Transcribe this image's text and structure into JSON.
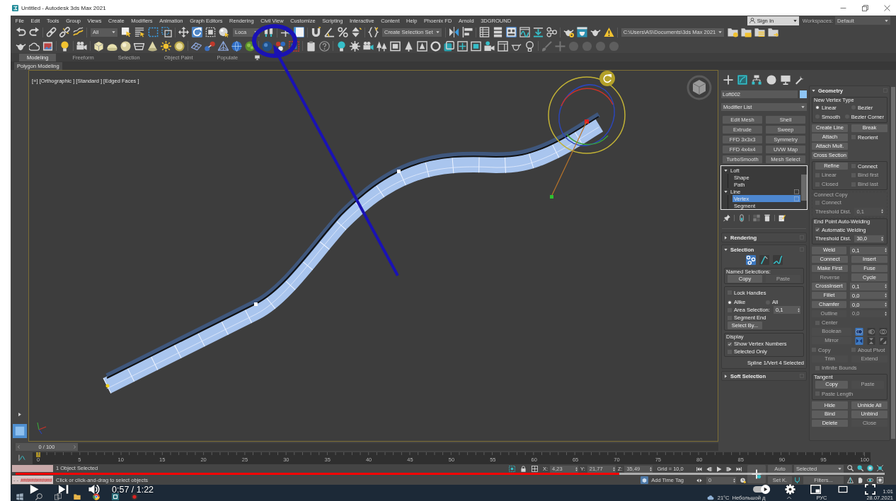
{
  "window": {
    "title": "Untitled - Autodesk 3ds Max 2021"
  },
  "menu": [
    "File",
    "Edit",
    "Tools",
    "Group",
    "Views",
    "Create",
    "Modifiers",
    "Animation",
    "Graph Editors",
    "Rendering",
    "Civil View",
    "Customize",
    "Scripting",
    "Interactive",
    "Content",
    "Help",
    "Phoenix FD",
    "Arnold",
    "3DGROUND"
  ],
  "account": {
    "sign_in": "Sign In",
    "workspaces_label": "Workspaces:",
    "workspace": "Default"
  },
  "main_toolbar": [
    [
      {
        "kind": "undo",
        "selected": false
      },
      {
        "kind": "redo",
        "selected": false
      }
    ],
    [
      {
        "kind": "link",
        "selected": false
      },
      {
        "kind": "unlink",
        "selected": false
      },
      {
        "kind": "bind",
        "selected": false
      }
    ],
    [
      {
        "kind": "dropdown",
        "value": "All"
      },
      {
        "kind": "selectobject",
        "selected": false
      },
      {
        "kind": "selectbyname",
        "selected": false
      },
      {
        "kind": "rectregion",
        "selected": false
      },
      {
        "kind": "crossing",
        "selected": false
      }
    ],
    [
      {
        "kind": "move",
        "selected": false
      },
      {
        "kind": "rotate",
        "selected": true
      },
      {
        "kind": "scale",
        "selected": false
      },
      {
        "kind": "place",
        "selected": false
      },
      {
        "kind": "dropdown",
        "value": "Loca"
      },
      {
        "kind": "pivot",
        "selected": false
      }
    ],
    [
      {
        "kind": "axis",
        "selected": false
      },
      {
        "kind": "panel",
        "selected": true
      }
    ],
    [
      {
        "kind": "snap",
        "selected": false
      },
      {
        "kind": "anglesnap",
        "selected": false
      },
      {
        "kind": "percentsnap",
        "selected": false
      },
      {
        "kind": "spinnersnap",
        "selected": false
      }
    ],
    [
      {
        "kind": "namedsets",
        "selected": false
      },
      {
        "kind": "dropdown",
        "value": "Create Selection Set"
      }
    ],
    [
      {
        "kind": "mirror",
        "selected": false
      },
      {
        "kind": "align",
        "selected": false
      }
    ],
    [
      {
        "kind": "explorer",
        "selected": false
      },
      {
        "kind": "layers",
        "selected": false
      },
      {
        "kind": "ribbon",
        "selected": true
      },
      {
        "kind": "curves",
        "selected": false
      },
      {
        "kind": "dope",
        "selected": false
      },
      {
        "kind": "schematic",
        "selected": false
      }
    ],
    [
      {
        "kind": "rendersetup",
        "selected": false
      },
      {
        "kind": "framewindow",
        "selected": false
      },
      {
        "kind": "render",
        "selected": false
      },
      {
        "kind": "warning",
        "selected": false
      }
    ],
    [
      {
        "kind": "dropdown",
        "value": "C:\\Users\\AS\\Documents\\3ds Max 2021"
      },
      {
        "kind": "project",
        "selected": false
      },
      {
        "kind": "projectopen",
        "selected": false
      },
      {
        "kind": "projectsets",
        "selected": false
      },
      {
        "kind": "projectpath",
        "selected": false
      }
    ]
  ],
  "ribbon": {
    "tabs": [
      {
        "label": "Modeling",
        "selected": true
      },
      {
        "label": "Freeform",
        "selected": false
      },
      {
        "label": "Selection",
        "selected": false
      },
      {
        "label": "Object Paint",
        "selected": false
      },
      {
        "label": "Populate",
        "selected": false
      }
    ],
    "panel": "Polygon Modeling"
  },
  "viewport": {
    "label": "[+] [Orthographic ] [Standard ] [Edged Faces ]"
  },
  "command_panel": {
    "tabs": [
      {
        "kind": "create",
        "selected": false
      },
      {
        "kind": "modify",
        "selected": true
      },
      {
        "kind": "hierarchy",
        "selected": false
      },
      {
        "kind": "motion",
        "selected": false
      },
      {
        "kind": "display",
        "selected": false
      },
      {
        "kind": "utilities",
        "selected": false
      }
    ],
    "object_name": "Loft002",
    "modifier_list": "Modifier List",
    "modifiers": [
      "Edit Mesh",
      "Shell",
      "Extrude",
      "Sweep",
      "FFD 3x3x3",
      "Symmetry",
      "FFD 4x4x4",
      "UVW Map",
      "TurboSmooth",
      "Mesh Select"
    ],
    "stack": [
      {
        "label": "Loft",
        "expanded": true,
        "selected": false,
        "children": [
          {
            "label": "Shape",
            "selected": false
          },
          {
            "label": "Path",
            "selected": false
          }
        ]
      },
      {
        "label": "Line",
        "expanded": true,
        "selected": false,
        "children": [
          {
            "label": "Vertex",
            "selected": true
          },
          {
            "label": "Segment",
            "selected": false
          }
        ]
      }
    ],
    "rollouts": [
      {
        "title": "Rendering",
        "expanded": false
      },
      {
        "title": "Selection",
        "expanded": true,
        "blocks": [
          {
            "kind": "row",
            "items": [
              {
                "kind": "vertex",
                "selected": true,
                "disabled": false
              },
              {
                "kind": "segment",
                "selected": false,
                "disabled": false
              },
              {
                "kind": "spline",
                "selected": false,
                "disabled": false
              }
            ]
          },
          {
            "kind": "group",
            "title": "Named Selections:",
            "disabled": false,
            "rows": [
              [
                {
                  "kind": "button",
                  "label": "Copy",
                  "disabled": false
                },
                {
                  "kind": "button",
                  "label": "Paste",
                  "disabled": true
                }
              ]
            ]
          },
          {
            "kind": "group",
            "disabled": false,
            "rows": [
              [
                {
                  "kind": "checkbox",
                  "label": "Lock Handles",
                  "checked": false,
                  "disabled": false
                }
              ],
              [
                {
                  "kind": "radio",
                  "label": "Alike",
                  "selected": true,
                  "disabled": false
                },
                {
                  "kind": "radio",
                  "label": "All",
                  "selected": false,
                  "disabled": false
                }
              ],
              [
                {
                  "kind": "checkbox",
                  "label": "Area Selection:",
                  "checked": false,
                  "disabled": false
                },
                {
                  "kind": "spinner",
                  "value": "0,1",
                  "disabled": false
                }
              ],
              [
                {
                  "kind": "checkbox",
                  "label": "Segment End",
                  "checked": false,
                  "disabled": false
                }
              ],
              [
                {
                  "kind": "button",
                  "label": "Select By...",
                  "disabled": false
                }
              ]
            ]
          },
          {
            "kind": "group",
            "title": "Display",
            "disabled": false,
            "rows": [
              [
                {
                  "kind": "checkbox",
                  "label": "Show Vertex Numbers",
                  "checked": true,
                  "disabled": false
                }
              ],
              [
                {
                  "kind": "checkbox",
                  "label": "Selected Only",
                  "checked": false,
                  "disabled": false
                }
              ]
            ]
          },
          {
            "kind": "row",
            "items": [
              {
                "kind": "label",
                "text": "Spline 1/Vert 4 Selected",
                "disabled": false
              }
            ]
          }
        ]
      },
      {
        "title": "Soft Selection",
        "expanded": false
      }
    ]
  },
  "geometry_rollout": {
    "title": "Geometry",
    "expanded": true,
    "blocks": [
      {
        "kind": "group",
        "title": "New Vertex Type",
        "disabled": false,
        "rows": [
          [
            {
              "kind": "radio",
              "label": "Linear",
              "selected": true,
              "disabled": false
            },
            {
              "kind": "radio",
              "label": "Bezier",
              "selected": false,
              "disabled": false
            }
          ],
          [
            {
              "kind": "radio",
              "label": "Smooth",
              "selected": false,
              "disabled": false
            },
            {
              "kind": "radio",
              "label": "Bezier Corner",
              "selected": false,
              "disabled": false
            }
          ]
        ]
      },
      {
        "kind": "row",
        "items": [
          {
            "kind": "button",
            "label": "Create Line",
            "disabled": false
          },
          {
            "kind": "button",
            "label": "Break",
            "disabled": false
          }
        ]
      },
      {
        "kind": "row",
        "items": [
          {
            "kind": "button",
            "label": "Attach",
            "disabled": false
          },
          {
            "kind": "checkbox",
            "label": "Reorient",
            "checked": false,
            "disabled": false
          }
        ]
      },
      {
        "kind": "row",
        "items": [
          {
            "kind": "button",
            "label": "Attach Mult.",
            "disabled": false
          }
        ]
      },
      {
        "kind": "row",
        "items": [
          {
            "kind": "button",
            "label": "Cross Section",
            "disabled": false
          }
        ]
      },
      {
        "kind": "group",
        "disabled": false,
        "rows": [
          [
            {
              "kind": "button",
              "label": "Refine",
              "disabled": false
            },
            {
              "kind": "checkbox",
              "label": "Connect",
              "checked": false,
              "disabled": false
            }
          ],
          [
            {
              "kind": "checkbox",
              "label": "Linear",
              "checked": false,
              "disabled": true
            },
            {
              "kind": "checkbox",
              "label": "Bind first",
              "checked": false,
              "disabled": true
            }
          ],
          [
            {
              "kind": "checkbox",
              "label": "Closed",
              "checked": false,
              "disabled": true
            },
            {
              "kind": "checkbox",
              "label": "Bind last",
              "checked": false,
              "disabled": true
            }
          ]
        ]
      },
      {
        "kind": "group",
        "title": "Connect Copy",
        "disabled": true,
        "rows": [
          [
            {
              "kind": "checkbox",
              "label": "Connect",
              "checked": false,
              "disabled": true
            }
          ],
          [
            {
              "kind": "label",
              "text": "Threshold Dist.",
              "disabled": true
            },
            {
              "kind": "spinner",
              "value": "0,1",
              "disabled": true
            }
          ]
        ]
      },
      {
        "kind": "group",
        "title": "End Point Auto-Welding",
        "disabled": false,
        "rows": [
          [
            {
              "kind": "checkbox",
              "label": "Automatic Welding",
              "checked": true,
              "disabled": false
            }
          ],
          [
            {
              "kind": "label",
              "text": "Threshold Dist.",
              "disabled": false
            },
            {
              "kind": "spinner",
              "value": "30,0",
              "disabled": false
            }
          ]
        ]
      },
      {
        "kind": "row",
        "items": [
          {
            "kind": "button",
            "label": "Weld",
            "disabled": false
          },
          {
            "kind": "spinner",
            "value": "0,1",
            "disabled": false
          }
        ]
      },
      {
        "kind": "row",
        "items": [
          {
            "kind": "button",
            "label": "Connect",
            "disabled": false
          },
          {
            "kind": "button",
            "label": "Insert",
            "disabled": false
          }
        ]
      },
      {
        "kind": "row",
        "items": [
          {
            "kind": "button",
            "label": "Make First",
            "disabled": false
          },
          {
            "kind": "button",
            "label": "Fuse",
            "disabled": false
          }
        ]
      },
      {
        "kind": "row",
        "items": [
          {
            "kind": "button",
            "label": "Reverse",
            "disabled": true
          },
          {
            "kind": "button",
            "label": "Cycle",
            "disabled": false
          }
        ]
      },
      {
        "kind": "row",
        "items": [
          {
            "kind": "button",
            "label": "CrossInsert",
            "disabled": false
          },
          {
            "kind": "spinner",
            "value": "0,1",
            "disabled": false
          }
        ]
      },
      {
        "kind": "row",
        "items": [
          {
            "kind": "button",
            "label": "Fillet",
            "disabled": false
          },
          {
            "kind": "spinner",
            "value": "0,0",
            "disabled": false
          }
        ]
      },
      {
        "kind": "row",
        "items": [
          {
            "kind": "button",
            "label": "Chamfer",
            "disabled": false
          },
          {
            "kind": "spinner",
            "value": "0,0",
            "disabled": false
          }
        ]
      },
      {
        "kind": "row",
        "items": [
          {
            "kind": "button",
            "label": "Outline",
            "disabled": true
          },
          {
            "kind": "spinner",
            "value": "0,0",
            "disabled": true
          }
        ]
      },
      {
        "kind": "row",
        "items": [
          {
            "kind": "checkbox",
            "label": "Center",
            "checked": false,
            "disabled": true
          }
        ]
      },
      {
        "kind": "row",
        "items": [
          {
            "kind": "button",
            "label": "Boolean",
            "disabled": true
          },
          {
            "kind": "union",
            "selected": true,
            "disabled": false
          },
          {
            "kind": "subtract",
            "selected": false,
            "disabled": false
          },
          {
            "kind": "intersect",
            "selected": false,
            "disabled": false
          }
        ]
      },
      {
        "kind": "row",
        "items": [
          {
            "kind": "button",
            "label": "Mirror",
            "disabled": true
          },
          {
            "kind": "mirrorh",
            "selected": true,
            "disabled": false
          },
          {
            "kind": "mirrorv",
            "selected": false,
            "disabled": false
          },
          {
            "kind": "mirrorboth",
            "selected": false,
            "disabled": false
          }
        ]
      },
      {
        "kind": "row",
        "items": [
          {
            "kind": "checkbox",
            "label": "Copy",
            "checked": false,
            "disabled": true
          },
          {
            "kind": "checkbox",
            "label": "About Pivot",
            "checked": false,
            "disabled": true
          }
        ]
      },
      {
        "kind": "row",
        "items": [
          {
            "kind": "button",
            "label": "Trim",
            "disabled": true
          },
          {
            "kind": "button",
            "label": "Extend",
            "disabled": true
          }
        ]
      },
      {
        "kind": "row",
        "items": [
          {
            "kind": "checkbox",
            "label": "Infinite Bounds",
            "checked": false,
            "disabled": true
          }
        ]
      },
      {
        "kind": "group",
        "title": "Tangent",
        "disabled": false,
        "rows": [
          [
            {
              "kind": "button",
              "label": "Copy",
              "disabled": false
            },
            {
              "kind": "button",
              "label": "Paste",
              "disabled": true
            }
          ],
          [
            {
              "kind": "checkbox",
              "label": "Paste Length",
              "checked": false,
              "disabled": true
            }
          ]
        ]
      },
      {
        "kind": "row",
        "items": [
          {
            "kind": "button",
            "label": "Hide",
            "disabled": false
          },
          {
            "kind": "button",
            "label": "Unhide All",
            "disabled": false
          }
        ]
      },
      {
        "kind": "row",
        "items": [
          {
            "kind": "button",
            "label": "Bind",
            "disabled": false
          },
          {
            "kind": "button",
            "label": "Unbind",
            "disabled": false
          }
        ]
      },
      {
        "kind": "row",
        "items": [
          {
            "kind": "button",
            "label": "Delete",
            "disabled": false
          },
          {
            "kind": "button",
            "label": "Close",
            "disabled": true
          }
        ]
      }
    ]
  },
  "timeline": {
    "frame": "0 / 100",
    "level": 0,
    "ticks": [
      "0",
      "5",
      "10",
      "15",
      "20",
      "25",
      "30",
      "35",
      "40",
      "45",
      "50",
      "55",
      "60",
      "65",
      "70",
      "75",
      "80",
      "85",
      "90",
      "95",
      "100"
    ]
  },
  "status_bar": {
    "listener": {
      "prompt": "- -",
      "output": "############"
    },
    "messages": [
      "1 Object Selected",
      "Click or click-and-drag to select objects"
    ],
    "coordinates": [
      {
        "axis": "X:",
        "value": "4,23"
      },
      {
        "axis": "Y:",
        "value": "21,77"
      },
      {
        "axis": "Z:",
        "value": "35,49"
      }
    ],
    "grid": "Grid = 10,0",
    "time_tag": "Add Time Tag",
    "frame": "0",
    "auto_key": "Auto",
    "set_key": "Set K.",
    "key_filter": "Selected",
    "filters": "Filters..."
  },
  "taskbar": {
    "temperature": "21°C",
    "weather": "Небольшой д",
    "language": "РУС",
    "time": "1:01",
    "date": "28.07.2021"
  },
  "player": {
    "time": "0:57 / 1:22",
    "level": 0.695,
    "autoplay": true
  }
}
